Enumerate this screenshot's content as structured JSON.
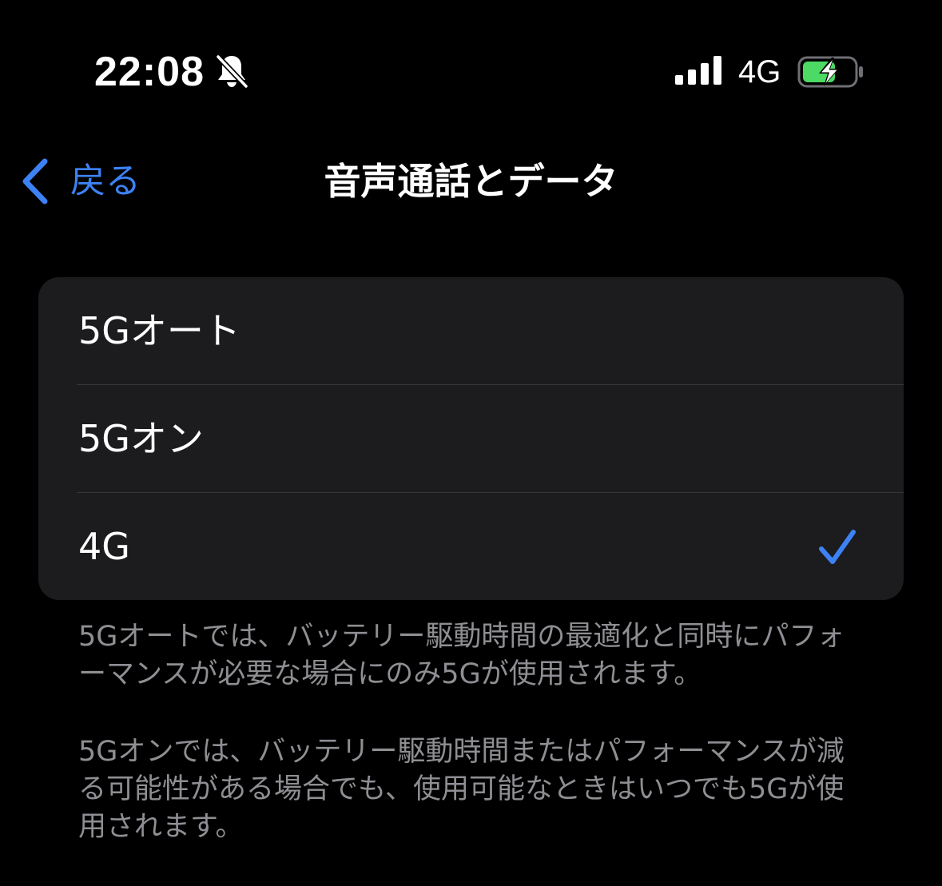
{
  "status_bar": {
    "time": "22:08",
    "silent_icon": "bell-slash-icon",
    "signal_icon": "cellular-signal-icon",
    "signal_bars": 4,
    "network": "4G",
    "battery_icon": "battery-charging-icon",
    "battery_color": "#4cd964"
  },
  "nav": {
    "back_label": "戻る",
    "title": "音声通話とデータ"
  },
  "options": {
    "items": [
      {
        "label": "5Gオート",
        "selected": false
      },
      {
        "label": "5Gオン",
        "selected": false
      },
      {
        "label": "4G",
        "selected": true
      }
    ]
  },
  "footer": {
    "note_auto": "5Gオートでは、バッテリー駆動時間の最適化と同時にパフォーマンスが必要な場合にのみ5Gが使用されます。",
    "note_on": "5Gオンでは、バッテリー駆動時間またはパフォーマンスが減る可能性がある場合でも、使用可能なときはいつでも5Gが使用されます。"
  },
  "colors": {
    "accent": "#3d82f5",
    "background": "#000000",
    "group_background": "#1c1c1e",
    "secondary_text": "#8e8e93",
    "separator": "#38383a"
  }
}
